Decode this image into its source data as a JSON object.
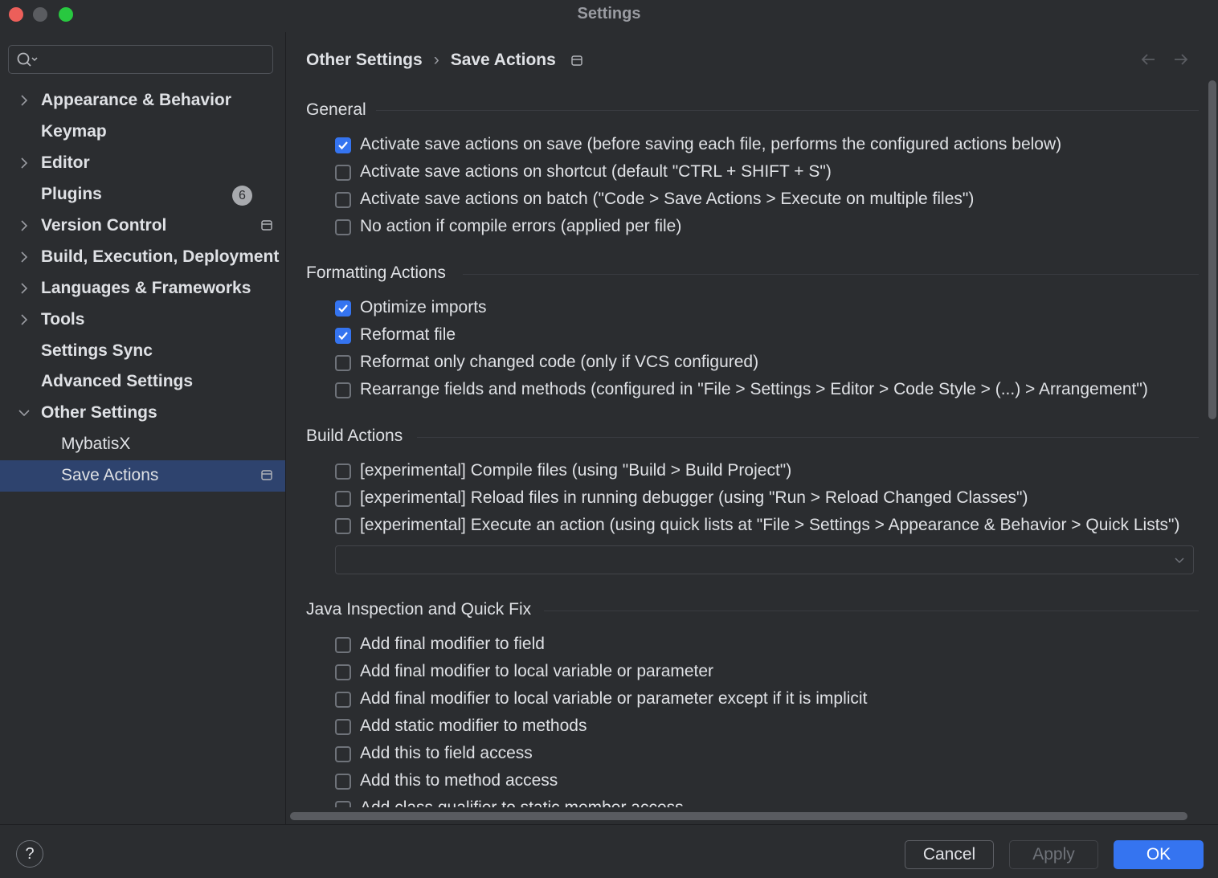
{
  "window": {
    "title": "Settings"
  },
  "search": {
    "placeholder": ""
  },
  "sidebar": {
    "items": [
      {
        "label": "Appearance & Behavior",
        "expandable": true
      },
      {
        "label": "Keymap"
      },
      {
        "label": "Editor",
        "expandable": true
      },
      {
        "label": "Plugins",
        "badge": "6"
      },
      {
        "label": "Version Control",
        "expandable": true
      },
      {
        "label": "Build, Execution, Deployment",
        "expandable": true
      },
      {
        "label": "Languages & Frameworks",
        "expandable": true
      },
      {
        "label": "Tools",
        "expandable": true
      },
      {
        "label": "Settings Sync"
      },
      {
        "label": "Advanced Settings"
      },
      {
        "label": "Other Settings",
        "expanded": true
      },
      {
        "label": "MybatisX"
      },
      {
        "label": "Save Actions",
        "selected": true
      }
    ]
  },
  "breadcrumb": {
    "parent": "Other Settings",
    "separator": "›",
    "current": "Save Actions"
  },
  "sections": {
    "general": {
      "title": "General",
      "options": [
        {
          "label": "Activate save actions on save (before saving each file, performs the configured actions below)",
          "checked": true
        },
        {
          "label": "Activate save actions on shortcut (default \"CTRL + SHIFT + S\")",
          "checked": false
        },
        {
          "label": "Activate save actions on batch (\"Code > Save Actions > Execute on multiple files\")",
          "checked": false
        },
        {
          "label": "No action if compile errors (applied per file)",
          "checked": false
        }
      ]
    },
    "formatting": {
      "title": "Formatting Actions",
      "options": [
        {
          "label": "Optimize imports",
          "checked": true
        },
        {
          "label": "Reformat file",
          "checked": true
        },
        {
          "label": "Reformat only changed code (only if VCS configured)",
          "checked": false
        },
        {
          "label": "Rearrange fields and methods (configured in \"File > Settings > Editor > Code Style > (...) > Arrangement\")",
          "checked": false
        }
      ]
    },
    "build": {
      "title": "Build Actions",
      "options": [
        {
          "label": "[experimental] Compile files (using \"Build > Build Project\")",
          "checked": false
        },
        {
          "label": "[experimental] Reload files in running debugger (using \"Run > Reload Changed Classes\")",
          "checked": false
        },
        {
          "label": "[experimental] Execute an action (using quick lists at \"File > Settings > Appearance & Behavior > Quick Lists\")",
          "checked": false
        }
      ],
      "quick_list_value": ""
    },
    "java": {
      "title": "Java Inspection and Quick Fix",
      "options": [
        {
          "label": "Add final modifier to field",
          "checked": false
        },
        {
          "label": "Add final modifier to local variable or parameter",
          "checked": false
        },
        {
          "label": "Add final modifier to local variable or parameter except if it is implicit",
          "checked": false
        },
        {
          "label": "Add static modifier to methods",
          "checked": false
        },
        {
          "label": "Add this to field access",
          "checked": false
        },
        {
          "label": "Add this to method access",
          "checked": false
        },
        {
          "label": "Add class qualifier to static member access",
          "checked": false
        }
      ]
    }
  },
  "footer": {
    "help_label": "?",
    "cancel_label": "Cancel",
    "apply_label": "Apply",
    "ok_label": "OK"
  },
  "colors": {
    "accent": "#3574f0",
    "background": "#2b2d30",
    "selection": "#2e436e"
  },
  "icons": [
    "search-icon",
    "chevron-right-icon",
    "chevron-down-icon",
    "project-icon",
    "back-arrow-icon",
    "forward-arrow-icon",
    "checkmark-icon",
    "dropdown-arrow-icon",
    "help-icon"
  ]
}
